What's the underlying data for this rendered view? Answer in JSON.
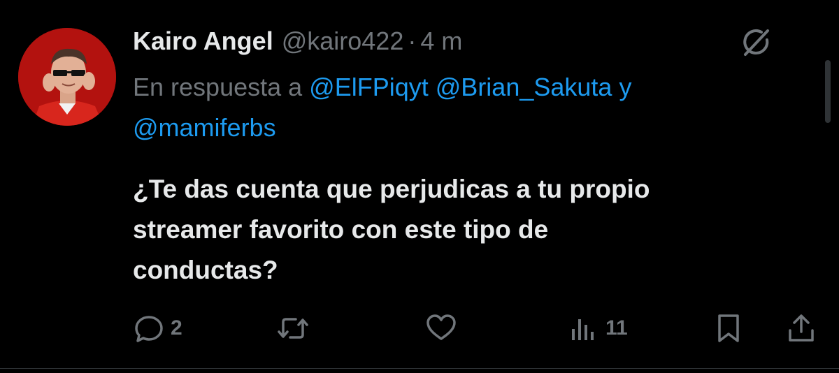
{
  "tweet": {
    "author": {
      "display_name": "Kairo Angel",
      "handle": "@kairo422",
      "separator": "·",
      "time": "4 m",
      "avatar_icon": "user-avatar"
    },
    "reply_to": {
      "prefix": "En respuesta a",
      "mention_1": "@ElFPiqyt",
      "mention_2": "@Brian_Sakuta",
      "conjunction": "y",
      "mention_3": "@mamiferbs"
    },
    "text": {
      "line_1": "¿Te das cuenta que perjudicas a tu propio",
      "line_2": "streamer favorito con este tipo de",
      "line_3": "conductas?"
    },
    "actions": {
      "reply": {
        "icon": "reply-icon",
        "count": "2"
      },
      "repost": {
        "icon": "repost-icon",
        "count": ""
      },
      "like": {
        "icon": "heart-icon",
        "count": ""
      },
      "views": {
        "icon": "views-icon",
        "count": "11"
      },
      "bookmark": {
        "icon": "bookmark-icon"
      },
      "share": {
        "icon": "share-icon"
      }
    }
  },
  "colors": {
    "background": "#000000",
    "primary_text": "#e7e9ea",
    "secondary_text": "#71767b",
    "mention": "#1d9bf0",
    "avatar_bg": "#b3120f"
  }
}
